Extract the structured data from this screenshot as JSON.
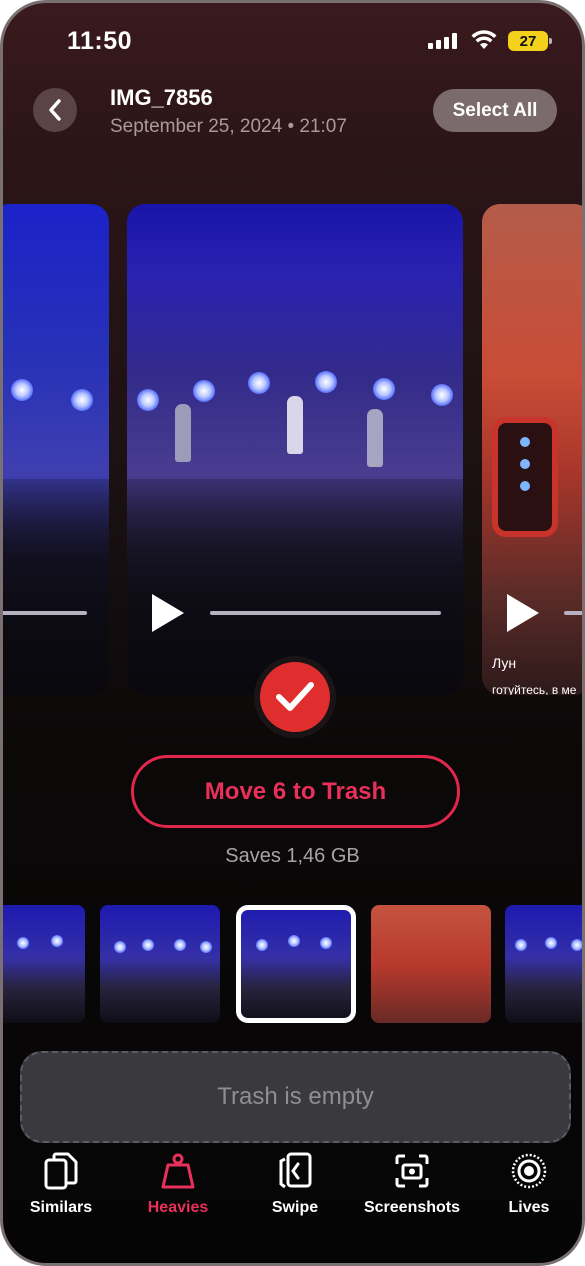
{
  "status_bar": {
    "time": "11:50",
    "battery": "27"
  },
  "header": {
    "title": "IMG_7856",
    "subtitle": "September 25, 2024 • 21:07",
    "select_all_label": "Select All"
  },
  "right_card": {
    "caption_line1": "Лун",
    "caption_line2": "готуйтесь, в ме"
  },
  "action": {
    "trash_label": "Move 6 to Trash",
    "saves_text": "Saves 1,46 GB"
  },
  "trash_box": {
    "label": "Trash is empty"
  },
  "tabs": [
    {
      "label": "Similars",
      "icon": "similars-icon"
    },
    {
      "label": "Heavies",
      "icon": "heavies-icon",
      "active": true
    },
    {
      "label": "Swipe",
      "icon": "swipe-icon"
    },
    {
      "label": "Screenshots",
      "icon": "screenshots-icon"
    },
    {
      "label": "Lives",
      "icon": "lives-icon"
    }
  ],
  "colors": {
    "accent": "#e8305a",
    "check_badge": "#e02e2e",
    "battery": "#f2d21a"
  }
}
